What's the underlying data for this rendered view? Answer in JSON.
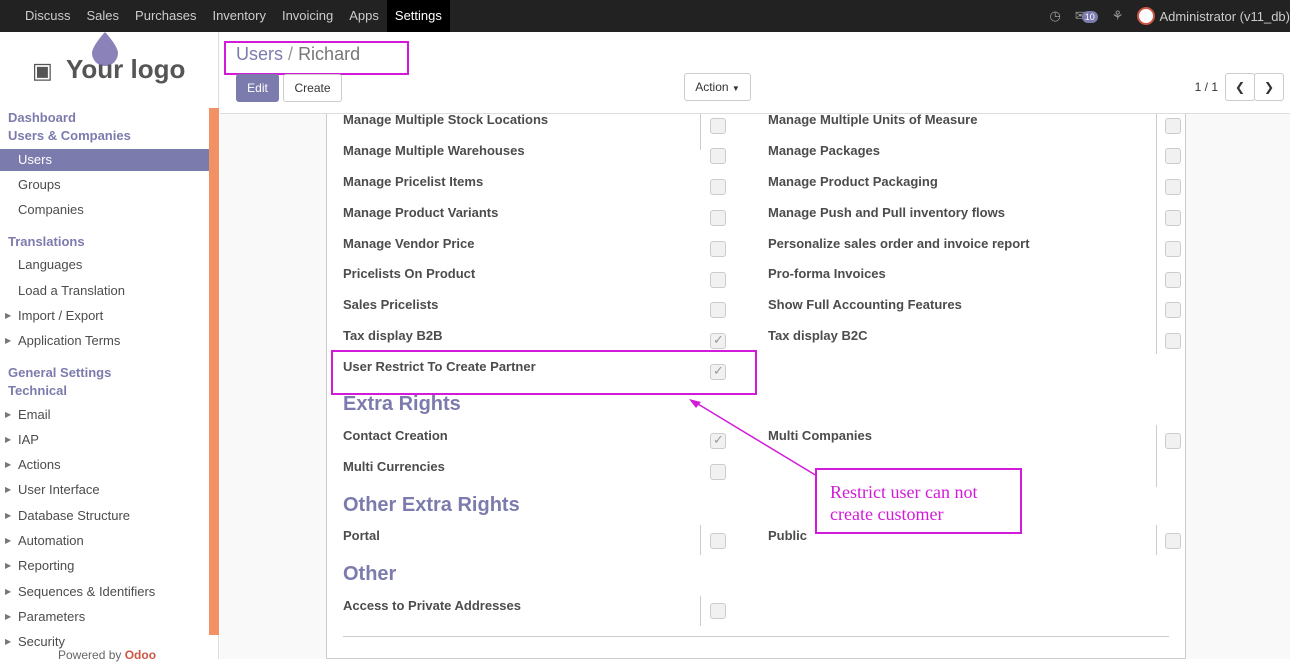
{
  "topbar": {
    "menu": [
      {
        "label": "Discuss",
        "active": false
      },
      {
        "label": "Sales",
        "active": false
      },
      {
        "label": "Purchases",
        "active": false
      },
      {
        "label": "Inventory",
        "active": false
      },
      {
        "label": "Invoicing",
        "active": false
      },
      {
        "label": "Apps",
        "active": false
      },
      {
        "label": "Settings",
        "active": true
      }
    ],
    "badge_count": "10",
    "user": "Administrator (v11_db)"
  },
  "sidebar": {
    "logo_text": "Your logo",
    "heads": {
      "dashboard": "Dashboard",
      "users_companies": "Users & Companies",
      "translations": "Translations",
      "general_settings": "General Settings",
      "technical": "Technical"
    },
    "items": [
      {
        "label": "Users",
        "active": true,
        "caret": false
      },
      {
        "label": "Groups",
        "active": false,
        "caret": false
      },
      {
        "label": "Companies",
        "active": false,
        "caret": false
      },
      {
        "label": "Languages",
        "active": false,
        "caret": false
      },
      {
        "label": "Load a Translation",
        "active": false,
        "caret": false
      },
      {
        "label": "Import / Export",
        "active": false,
        "caret": true
      },
      {
        "label": "Application Terms",
        "active": false,
        "caret": true
      },
      {
        "label": "Email",
        "active": false,
        "caret": true
      },
      {
        "label": "IAP",
        "active": false,
        "caret": true
      },
      {
        "label": "Actions",
        "active": false,
        "caret": true
      },
      {
        "label": "User Interface",
        "active": false,
        "caret": true
      },
      {
        "label": "Database Structure",
        "active": false,
        "caret": true
      },
      {
        "label": "Automation",
        "active": false,
        "caret": true
      },
      {
        "label": "Reporting",
        "active": false,
        "caret": true
      },
      {
        "label": "Sequences & Identifiers",
        "active": false,
        "caret": true
      },
      {
        "label": "Parameters",
        "active": false,
        "caret": true
      },
      {
        "label": "Security",
        "active": false,
        "caret": true
      }
    ],
    "powered_prefix": "Powered by",
    "powered_brand": "Odoo"
  },
  "control_panel": {
    "breadcrumb_parent": "Users",
    "breadcrumb_sep": "/",
    "breadcrumb_current": "Richard",
    "edit_label": "Edit",
    "create_label": "Create",
    "action_label": "Action",
    "pager": "1 / 1"
  },
  "form": {
    "rows": [
      {
        "left": "Manage Multiple Stock Locations",
        "left_checked": false,
        "right": "Manage Multiple Units of Measure",
        "right_checked": false
      },
      {
        "left": "Manage Multiple Warehouses",
        "left_checked": false,
        "right": "Manage Packages",
        "right_checked": false
      },
      {
        "left": "Manage Pricelist Items",
        "left_checked": false,
        "right": "Manage Product Packaging",
        "right_checked": false
      },
      {
        "left": "Manage Product Variants",
        "left_checked": false,
        "right": "Manage Push and Pull inventory flows",
        "right_checked": false
      },
      {
        "left": "Manage Vendor Price",
        "left_checked": false,
        "right": "Personalize sales order and invoice report",
        "right_checked": false
      },
      {
        "left": "Pricelists On Product",
        "left_checked": false,
        "right": "Pro-forma Invoices",
        "right_checked": false
      },
      {
        "left": "Sales Pricelists",
        "left_checked": false,
        "right": "Show Full Accounting Features",
        "right_checked": false
      },
      {
        "left": "Tax display B2B",
        "left_checked": true,
        "right": "Tax display B2C",
        "right_checked": false
      },
      {
        "left": "User Restrict To Create Partner",
        "left_checked": true,
        "right": "",
        "right_checked": false
      }
    ],
    "extra_rights": {
      "title": "Extra Rights",
      "rows": [
        {
          "left": "Contact Creation",
          "left_checked": true,
          "right": "Multi Companies",
          "right_checked": false
        },
        {
          "left": "Multi Currencies",
          "left_checked": false,
          "right": "",
          "right_checked": false
        }
      ]
    },
    "other_extra_rights": {
      "title": "Other Extra Rights",
      "rows": [
        {
          "left": "Portal",
          "left_checked": false,
          "right": "Public",
          "right_checked": false
        }
      ]
    },
    "other": {
      "title": "Other",
      "rows": [
        {
          "left": "Access to Private Addresses",
          "left_checked": false
        }
      ]
    }
  },
  "annotation": {
    "note_line1": "Restrict user can not",
    "note_line2": "create customer",
    "color": "#d21bd9"
  }
}
